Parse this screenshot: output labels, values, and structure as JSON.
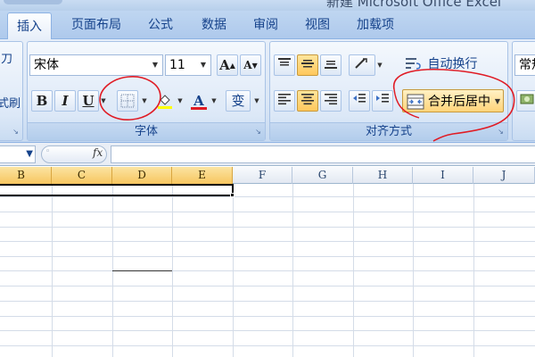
{
  "window": {
    "title": "新建 Microsoft Office Excel"
  },
  "tabs": [
    "插入",
    "页面布局",
    "公式",
    "数据",
    "审阅",
    "视图",
    "加载项"
  ],
  "clipboard_partial": [
    "刀",
    "",
    "式刷"
  ],
  "font_group": {
    "label": "字体",
    "font_name": "宋体",
    "font_size": "11",
    "bold": "B",
    "italic": "I",
    "underline": "U",
    "grow_font": "A",
    "shrink_font": "A",
    "font_color_glyph": "A",
    "phonetic_glyph": "变"
  },
  "alignment_group": {
    "label": "对齐方式",
    "wrap_text": "自动换行",
    "merge_center": "合并后居中"
  },
  "number_group_partial": {
    "format": "常规"
  },
  "formula_bar": {
    "fx": "fx",
    "value": ""
  },
  "columns": [
    "B",
    "C",
    "D",
    "E",
    "F",
    "G",
    "H",
    "I",
    "J"
  ],
  "selected_columns": [
    "B",
    "C",
    "D",
    "E"
  ],
  "colors": {
    "accent_red": "#e01b24",
    "highlight": "#ffd47a",
    "ribbon": "#dbe7f6"
  }
}
